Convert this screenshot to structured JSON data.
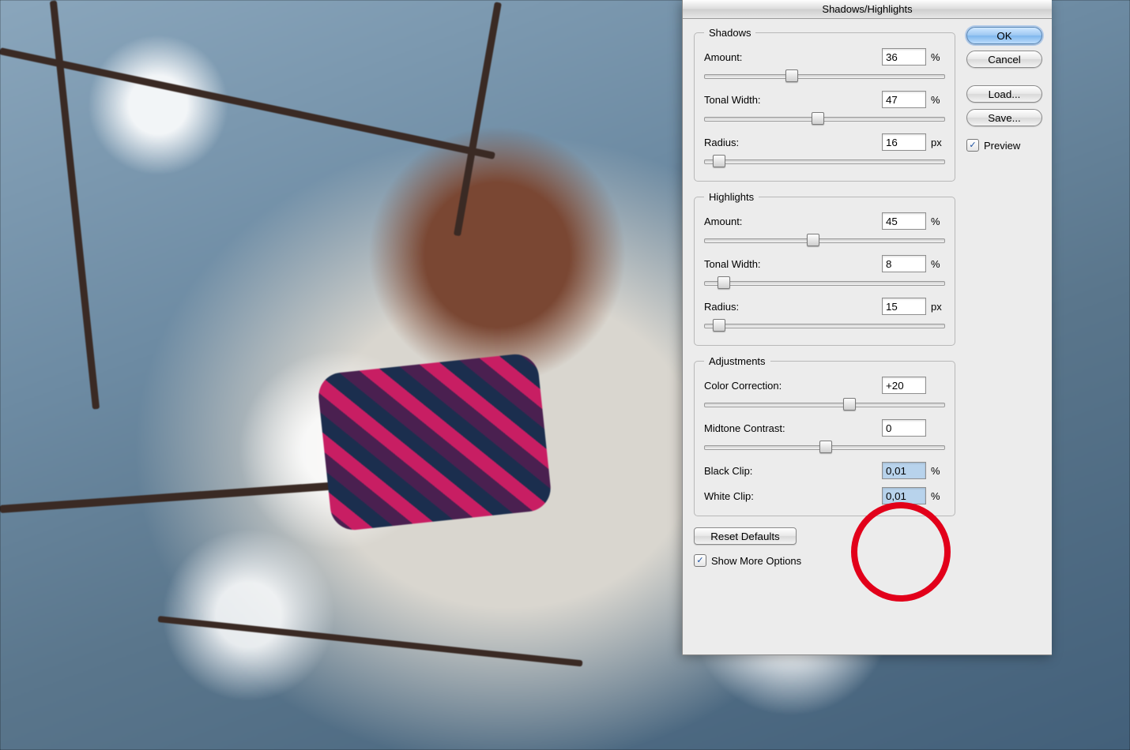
{
  "dialog": {
    "title": "Shadows/Highlights",
    "shadows": {
      "legend": "Shadows",
      "amount": {
        "label": "Amount:",
        "value": "36",
        "unit": "%",
        "pos": 36
      },
      "tonalWidth": {
        "label": "Tonal Width:",
        "value": "47",
        "unit": "%",
        "pos": 47
      },
      "radius": {
        "label": "Radius:",
        "value": "16",
        "unit": "px",
        "pos": 6
      }
    },
    "highlights": {
      "legend": "Highlights",
      "amount": {
        "label": "Amount:",
        "value": "45",
        "unit": "%",
        "pos": 45
      },
      "tonalWidth": {
        "label": "Tonal Width:",
        "value": "8",
        "unit": "%",
        "pos": 8
      },
      "radius": {
        "label": "Radius:",
        "value": "15",
        "unit": "px",
        "pos": 6
      }
    },
    "adjustments": {
      "legend": "Adjustments",
      "colorCorrection": {
        "label": "Color Correction:",
        "value": "+20",
        "pos": 60
      },
      "midtoneContrast": {
        "label": "Midtone Contrast:",
        "value": "0",
        "pos": 50
      },
      "blackClip": {
        "label": "Black Clip:",
        "value": "0,01",
        "unit": "%"
      },
      "whiteClip": {
        "label": "White Clip:",
        "value": "0,01",
        "unit": "%"
      }
    },
    "resetDefaults": "Reset Defaults",
    "showMoreOptions": {
      "label": "Show More Options",
      "checked": true
    }
  },
  "buttons": {
    "ok": "OK",
    "cancel": "Cancel",
    "load": "Load...",
    "save": "Save..."
  },
  "preview": {
    "label": "Preview",
    "checked": true
  },
  "annotation": {
    "circleColor": "#e2001a"
  }
}
